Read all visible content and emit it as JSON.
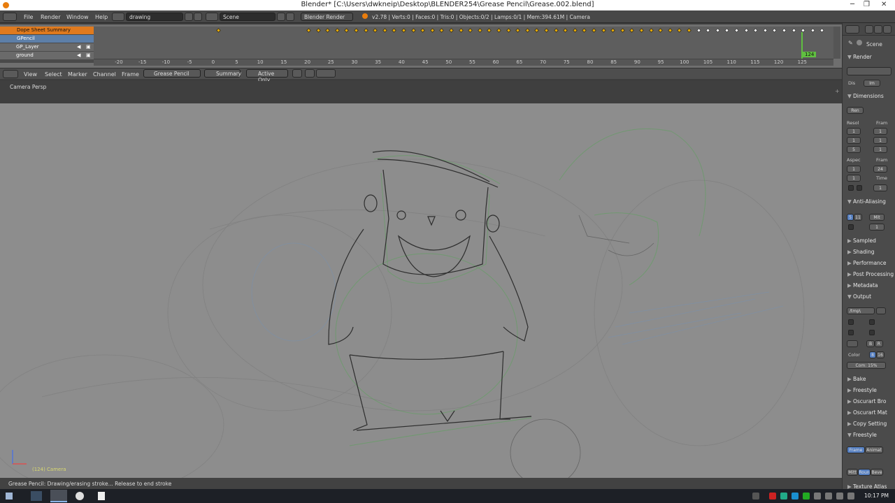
{
  "titlebar": {
    "title": "Blender* [C:\\Users\\dwkneip\\Desktop\\BLENDER254\\Grease Pencil\\Grease.002.blend]",
    "minimize": "─",
    "maximize": "❐",
    "close": "✕"
  },
  "infobar": {
    "menus": [
      "File",
      "Render",
      "Window",
      "Help"
    ],
    "screen_layout": "drawing",
    "scene": "Scene",
    "render_engine": "Blender Render",
    "stats": "v2.78 | Verts:0 | Faces:0 | Tris:0 | Objects:0/2 | Lamps:0/1 | Mem:394.61M | Camera"
  },
  "dopesheet": {
    "channels": [
      {
        "label": "Dope Sheet Summary",
        "kind": "summary"
      },
      {
        "label": "GPencil",
        "kind": "object"
      },
      {
        "label": "GP_Layer",
        "kind": "layer"
      },
      {
        "label": "ground",
        "kind": "layer"
      }
    ],
    "ruler_ticks": [
      "-20",
      "-15",
      "-10",
      "-5",
      "0",
      "5",
      "10",
      "15",
      "20",
      "25",
      "30",
      "35",
      "40",
      "45",
      "50",
      "55",
      "60",
      "65",
      "70",
      "75",
      "80",
      "85",
      "90",
      "95",
      "100",
      "105",
      "110",
      "115",
      "120",
      "125"
    ],
    "current_frame": "124"
  },
  "ds_header": {
    "menus": [
      "View",
      "Select",
      "Marker",
      "Channel",
      "Frame"
    ],
    "mode": "Grease Pencil",
    "summary_label": "Summary",
    "active_only_label": "Active Only"
  },
  "viewport": {
    "label": "Camera Persp",
    "frame_info": "(124) Camera"
  },
  "status": {
    "text": "Grease Pencil: Drawing/erasing stroke... Release to end stroke"
  },
  "properties": {
    "tabs": [
      "render-icon",
      "layers-icon",
      "scene-icon",
      "world-icon"
    ],
    "scene_label": "Scene",
    "panels": [
      {
        "label": "Render",
        "open": true
      },
      {
        "label": "Dimensions",
        "open": true
      },
      {
        "label": "Anti-Aliasing",
        "open": true
      },
      {
        "label": "Sampled",
        "open": false
      },
      {
        "label": "Shading",
        "open": false
      },
      {
        "label": "Performance",
        "open": false
      },
      {
        "label": "Post Processing",
        "open": false
      },
      {
        "label": "Metadata",
        "open": false
      },
      {
        "label": "Output",
        "open": true
      },
      {
        "label": "Bake",
        "open": false
      },
      {
        "label": "Freestyle",
        "open": false
      },
      {
        "label": "Oscurart Bro",
        "open": false
      },
      {
        "label": "Oscurart Mat",
        "open": false
      },
      {
        "label": "Copy Setting",
        "open": false
      },
      {
        "label": "Freestyle",
        "open": true
      },
      {
        "label": "Texture Atlas",
        "open": false
      }
    ],
    "display_label": "Dis",
    "display_value": "Im",
    "preset": "Ren",
    "resol_label": "Resol",
    "fram_label": "Fram",
    "aspect_label": "Aspec",
    "frame_rate_label": "Fram",
    "frame_rate_value": "24",
    "time_label": "Time",
    "aa_samples": [
      "5",
      "11"
    ],
    "aa_filter": "Mit",
    "aa_size": "1",
    "output_path": "/tmp\\",
    "color_label": "Color",
    "color_depth": [
      "8",
      "16"
    ],
    "compression": "Com: 15%",
    "bw_rgb": [
      "B",
      "R"
    ],
    "freestyle_tabs": [
      "Frame",
      "Animat"
    ],
    "freestyle_bottom": [
      "Mitt",
      "Roun",
      "Beve"
    ]
  },
  "taskbar": {
    "clock": "10:17 PM"
  }
}
